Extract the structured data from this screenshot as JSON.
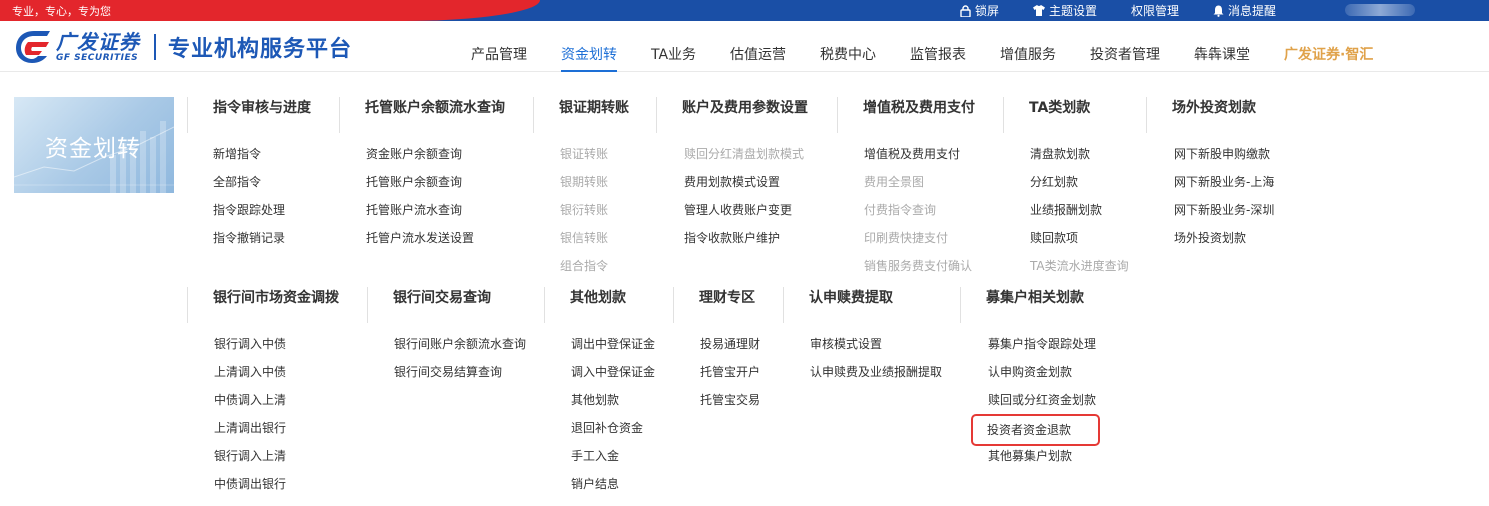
{
  "topbar": {
    "slogan": "专业，专心，专为您",
    "tools": [
      {
        "icon": "lock-icon",
        "label": "锁屏"
      },
      {
        "icon": "shirt-icon",
        "label": "主题设置"
      },
      {
        "icon": "",
        "label": "权限管理"
      },
      {
        "icon": "bell-icon",
        "label": "消息提醒"
      }
    ],
    "colors": {
      "red": "#e3262c",
      "blue": "#1a4fa6"
    }
  },
  "header": {
    "brand_cn": "广发证券",
    "brand_en": "GF SECURITIES",
    "platform_title": "专业机构服务平台",
    "nav": [
      {
        "label": "产品管理",
        "active": false
      },
      {
        "label": "资金划转",
        "active": true
      },
      {
        "label": "TA业务",
        "active": false
      },
      {
        "label": "估值运营",
        "active": false
      },
      {
        "label": "税费中心",
        "active": false
      },
      {
        "label": "监管报表",
        "active": false
      },
      {
        "label": "增值服务",
        "active": false
      },
      {
        "label": "投资者管理",
        "active": false
      },
      {
        "label": "犇犇课堂",
        "active": false
      },
      {
        "label": "广发证券·智汇",
        "active": false
      }
    ],
    "accent": "#1d6fd6"
  },
  "banner": {
    "title": "资金划转"
  },
  "menu": {
    "row1": [
      {
        "title": "指令审核与进度",
        "items": [
          {
            "label": "新增指令",
            "disabled": false
          },
          {
            "label": "全部指令",
            "disabled": false
          },
          {
            "label": "指令跟踪处理",
            "disabled": false
          },
          {
            "label": "指令撤销记录",
            "disabled": false
          }
        ]
      },
      {
        "title": "托管账户余额流水查询",
        "items": [
          {
            "label": "资金账户余额查询",
            "disabled": false
          },
          {
            "label": "托管账户余额查询",
            "disabled": false
          },
          {
            "label": "托管账户流水查询",
            "disabled": false
          },
          {
            "label": "托管户流水发送设置",
            "disabled": false
          }
        ]
      },
      {
        "title": "银证期转账",
        "items": [
          {
            "label": "银证转账",
            "disabled": true
          },
          {
            "label": "银期转账",
            "disabled": true
          },
          {
            "label": "银衍转账",
            "disabled": true
          },
          {
            "label": "银信转账",
            "disabled": true
          },
          {
            "label": "组合指令",
            "disabled": true
          }
        ]
      },
      {
        "title": "账户及费用参数设置",
        "items": [
          {
            "label": "赎回分红清盘划款模式",
            "disabled": true
          },
          {
            "label": "费用划款模式设置",
            "disabled": false
          },
          {
            "label": "管理人收费账户变更",
            "disabled": false
          },
          {
            "label": "指令收款账户维护",
            "disabled": false
          }
        ]
      },
      {
        "title": "增值税及费用支付",
        "items": [
          {
            "label": "增值税及费用支付",
            "disabled": false
          },
          {
            "label": "费用全景图",
            "disabled": true
          },
          {
            "label": "付费指令查询",
            "disabled": true
          },
          {
            "label": "印刷费快捷支付",
            "disabled": true
          },
          {
            "label": "销售服务费支付确认",
            "disabled": true
          }
        ]
      },
      {
        "title": "TA类划款",
        "items": [
          {
            "label": "清盘款划款",
            "disabled": false
          },
          {
            "label": "分红划款",
            "disabled": false
          },
          {
            "label": "业绩报酬划款",
            "disabled": false
          },
          {
            "label": "赎回款项",
            "disabled": false
          },
          {
            "label": "TA类流水进度查询",
            "disabled": true
          }
        ]
      },
      {
        "title": "场外投资划款",
        "items": [
          {
            "label": "网下新股申购缴款",
            "disabled": false
          },
          {
            "label": "网下新股业务-上海",
            "disabled": false
          },
          {
            "label": "网下新股业务-深圳",
            "disabled": false
          },
          {
            "label": "场外投资划款",
            "disabled": false
          }
        ]
      }
    ],
    "row2": [
      {
        "title": "银行间市场资金调拨",
        "items": [
          {
            "label": "银行调入中债",
            "disabled": false
          },
          {
            "label": "上清调入中债",
            "disabled": false
          },
          {
            "label": "中债调入上清",
            "disabled": false
          },
          {
            "label": "上清调出银行",
            "disabled": false
          },
          {
            "label": "银行调入上清",
            "disabled": false
          },
          {
            "label": "中债调出银行",
            "disabled": false
          }
        ]
      },
      {
        "title": "银行间交易查询",
        "items": [
          {
            "label": "银行间账户余额流水查询",
            "disabled": false
          },
          {
            "label": "银行间交易结算查询",
            "disabled": false
          }
        ]
      },
      {
        "title": "其他划款",
        "items": [
          {
            "label": "调出中登保证金",
            "disabled": false
          },
          {
            "label": "调入中登保证金",
            "disabled": false
          },
          {
            "label": "其他划款",
            "disabled": false
          },
          {
            "label": "退回补仓资金",
            "disabled": false
          },
          {
            "label": "手工入金",
            "disabled": false
          },
          {
            "label": "销户结息",
            "disabled": false
          }
        ]
      },
      {
        "title": "理财专区",
        "items": [
          {
            "label": "投易通理财",
            "disabled": false
          },
          {
            "label": "托管宝开户",
            "disabled": false
          },
          {
            "label": "托管宝交易",
            "disabled": false
          }
        ]
      },
      {
        "title": "认申赎费提取",
        "items": [
          {
            "label": "审核模式设置",
            "disabled": false
          },
          {
            "label": "认申赎费及业绩报酬提取",
            "disabled": false
          }
        ]
      },
      {
        "title": "募集户相关划款",
        "items": [
          {
            "label": "募集户指令跟踪处理",
            "disabled": false
          },
          {
            "label": "认申购资金划款",
            "disabled": false
          },
          {
            "label": "赎回或分红资金划款",
            "disabled": false
          },
          {
            "label": "投资者资金退款",
            "disabled": false,
            "highlighted": true
          },
          {
            "label": "其他募集户划款",
            "disabled": false
          }
        ]
      }
    ]
  }
}
